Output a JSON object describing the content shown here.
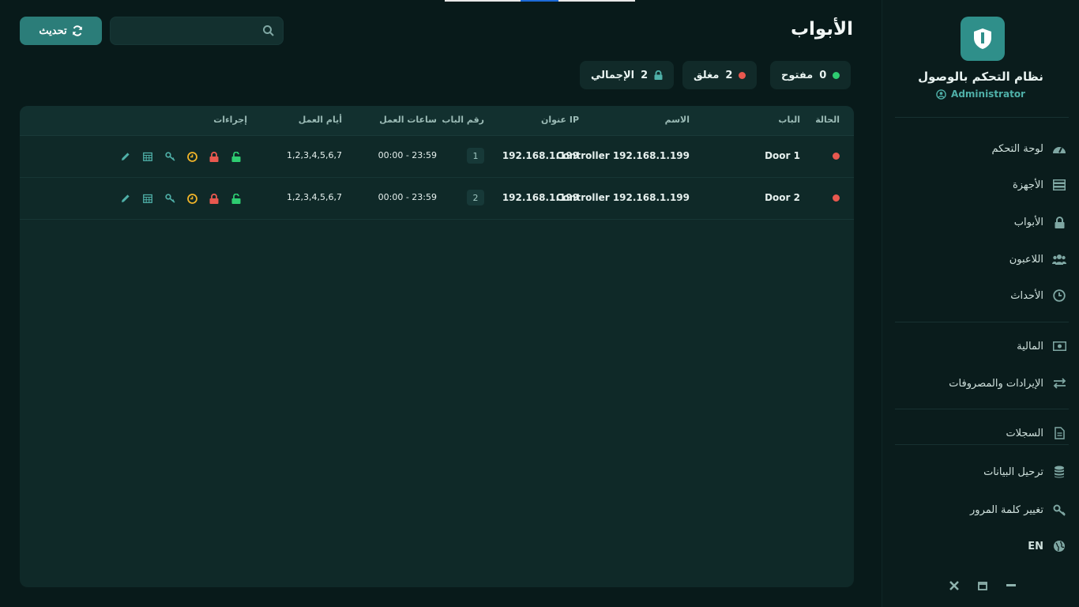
{
  "sidebar": {
    "app_title": "نظام التحكم بالوصول",
    "user": "Administrator",
    "items": [
      {
        "label": "لوحة التحكم",
        "icon": "dashboard-icon"
      },
      {
        "label": "الأجهزة",
        "icon": "server-icon"
      },
      {
        "label": "الأبواب",
        "icon": "lock-icon"
      },
      {
        "label": "اللاعبون",
        "icon": "users-icon"
      },
      {
        "label": "الأحداث",
        "icon": "clock-icon"
      },
      {
        "label": "المالية",
        "icon": "money-icon"
      },
      {
        "label": "الإيرادات والمصروفات",
        "icon": "exchange-icon"
      },
      {
        "label": "السجلات",
        "icon": "document-icon"
      },
      {
        "label": "ترحيل البيانات",
        "icon": "database-icon"
      },
      {
        "label": "تغيير كلمة المرور",
        "icon": "key-icon"
      },
      {
        "label": "EN",
        "icon": "globe-icon"
      }
    ]
  },
  "header": {
    "title": "الأبواب",
    "refresh_label": "تحديث",
    "search_placeholder": ""
  },
  "stats": {
    "open_count": "0",
    "open_label": "مفتوح",
    "closed_count": "2",
    "closed_label": "مغلق",
    "total_count": "2",
    "total_label": "الإجمالي"
  },
  "table": {
    "headers": {
      "status": "الحالة",
      "door": "الباب",
      "name": "الاسم",
      "ip": "عنوان IP",
      "door_no": "رقم الباب",
      "hours": "ساعات العمل",
      "days": "أيام العمل",
      "actions": "إجراءات"
    },
    "rows": [
      {
        "door": "Door 1",
        "name": "Controller 192.168.1.199",
        "ip": "192.168.1.199",
        "door_no": "1",
        "hours": "00:00 - 23:59",
        "days": "1,2,3,4,5,6,7"
      },
      {
        "door": "Door 2",
        "name": "Controller 192.168.1.199",
        "ip": "192.168.1.199",
        "door_no": "2",
        "hours": "00:00 - 23:59",
        "days": "1,2,3,4,5,6,7"
      }
    ]
  },
  "colors": {
    "accent": "#2b7d79",
    "open": "#2ecc71",
    "closed": "#e8584f",
    "warning": "#f0b429"
  }
}
